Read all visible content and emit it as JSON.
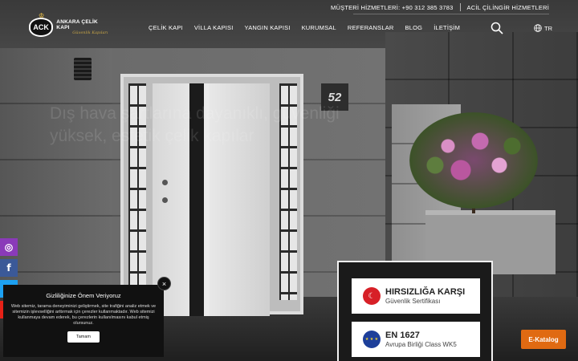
{
  "topbar": {
    "customer_service": "MÜŞTERİ HİZMETLERİ: +90 312 385 3783",
    "emergency": "ACİL ÇİLİNGİR HİZMETLERİ"
  },
  "logo": {
    "badge": "ACK",
    "name": "ANKARA ÇELİK KAPI",
    "tagline": "Güvenlik Kapıları"
  },
  "nav": {
    "items": [
      "ÇELİK KAPI",
      "VİLLA KAPISI",
      "YANGIN KAPISI",
      "KURUMSAL",
      "REFERANSLAR",
      "BLOG",
      "İLETİŞİM"
    ],
    "language": "TR"
  },
  "hero": {
    "text": "Dış hava şartlarına dayanıklı, güvenliği yüksek, estetik çelik kapılar",
    "door_number": "52"
  },
  "social": {
    "instagram": "◎",
    "facebook": "f",
    "twitter": "t",
    "youtube": "▶"
  },
  "cookie": {
    "title": "Gizliliğinize Önem Veriyoruz",
    "body": "Web sitemiz, tarama deneyiminizi geliştirmek, site trafiğini analiz etmek ve sitemizin işlevselliğini arttırmak için çerezler kullanmaktadır. Web sitemizi kullanmaya devam ederek, bu çerezlerin kullanılmasını kabul etmiş olursunuz.",
    "button": "Tamam",
    "close": "×"
  },
  "certificates": [
    {
      "title": "HIRSIZLIĞA KARŞI",
      "subtitle": "Güvenlik Sertifikası",
      "flag_icon": "☾",
      "flag_name": "turkey-flag-icon"
    },
    {
      "title": "EN 1627",
      "subtitle": "Avrupa Birliği Class WK5",
      "flag_icon": "★ ★ ★",
      "flag_name": "eu-flag-icon"
    }
  ],
  "ekatalog": "E-Katalog",
  "colors": {
    "accent": "#e06a12",
    "gold": "#c9a646",
    "instagram": "#8a3ab9",
    "facebook": "#3b5998",
    "twitter": "#1da1f2",
    "youtube": "#e62117"
  }
}
